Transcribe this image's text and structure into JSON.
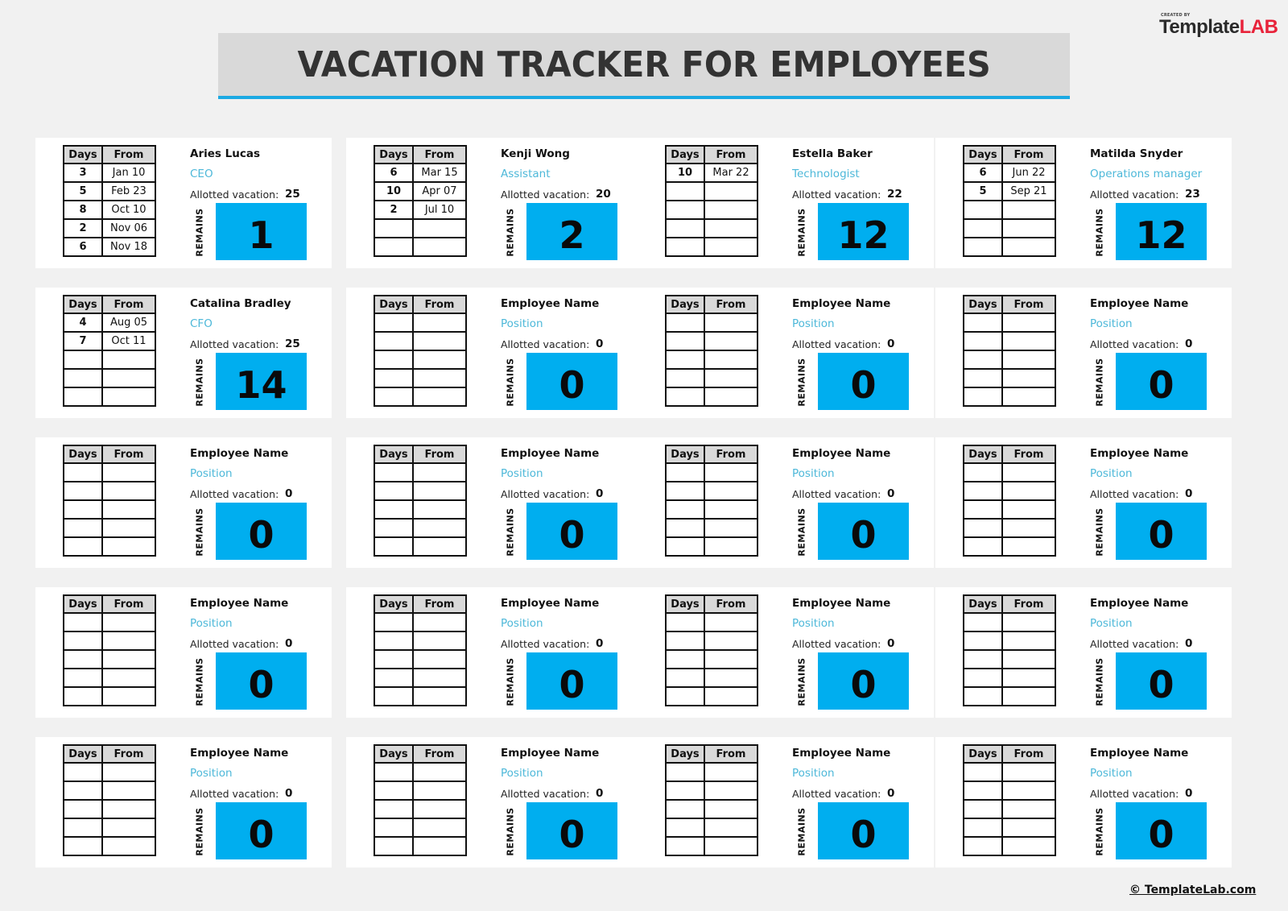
{
  "logo": {
    "created_by": "CREATED BY",
    "brand_part1": "Template",
    "brand_part2": "LAB"
  },
  "title": "VACATION TRACKER FOR EMPLOYEES",
  "table_headers": {
    "days": "Days",
    "from": "From"
  },
  "labels": {
    "allotted": "Allotted vacation:",
    "remains": "REMAINS"
  },
  "colors": {
    "accent": "#00aeef",
    "position_text": "#4db8d9",
    "header_fill": "#d9d9d9",
    "logo_red": "#e8233a"
  },
  "employees": [
    {
      "name": "Aries Lucas",
      "position": "CEO",
      "allotted": "25",
      "remains": "1",
      "rows": [
        {
          "days": "3",
          "from": "Jan 10"
        },
        {
          "days": "5",
          "from": "Feb 23"
        },
        {
          "days": "8",
          "from": "Oct 10"
        },
        {
          "days": "2",
          "from": "Nov 06"
        },
        {
          "days": "6",
          "from": "Nov 18"
        }
      ]
    },
    {
      "name": "Kenji Wong",
      "position": "Assistant",
      "allotted": "20",
      "remains": "2",
      "rows": [
        {
          "days": "6",
          "from": "Mar 15"
        },
        {
          "days": "10",
          "from": "Apr 07"
        },
        {
          "days": "2",
          "from": "Jul 10"
        },
        {
          "days": "",
          "from": ""
        },
        {
          "days": "",
          "from": ""
        }
      ]
    },
    {
      "name": "Estella Baker",
      "position": "Technologist",
      "allotted": "22",
      "remains": "12",
      "rows": [
        {
          "days": "10",
          "from": "Mar 22"
        },
        {
          "days": "",
          "from": ""
        },
        {
          "days": "",
          "from": ""
        },
        {
          "days": "",
          "from": ""
        },
        {
          "days": "",
          "from": ""
        }
      ]
    },
    {
      "name": "Matilda Snyder",
      "position": "Operations manager",
      "allotted": "23",
      "remains": "12",
      "rows": [
        {
          "days": "6",
          "from": "Jun 22"
        },
        {
          "days": "5",
          "from": "Sep 21"
        },
        {
          "days": "",
          "from": ""
        },
        {
          "days": "",
          "from": ""
        },
        {
          "days": "",
          "from": ""
        }
      ]
    },
    {
      "name": "Catalina Bradley",
      "position": "CFO",
      "allotted": "25",
      "remains": "14",
      "rows": [
        {
          "days": "4",
          "from": "Aug 05"
        },
        {
          "days": "7",
          "from": "Oct 11"
        },
        {
          "days": "",
          "from": ""
        },
        {
          "days": "",
          "from": ""
        },
        {
          "days": "",
          "from": ""
        }
      ]
    },
    {
      "name": "Employee Name",
      "position": "Position",
      "allotted": "0",
      "remains": "0",
      "rows": [
        {
          "days": "",
          "from": ""
        },
        {
          "days": "",
          "from": ""
        },
        {
          "days": "",
          "from": ""
        },
        {
          "days": "",
          "from": ""
        },
        {
          "days": "",
          "from": ""
        }
      ]
    },
    {
      "name": "Employee Name",
      "position": "Position",
      "allotted": "0",
      "remains": "0",
      "rows": [
        {
          "days": "",
          "from": ""
        },
        {
          "days": "",
          "from": ""
        },
        {
          "days": "",
          "from": ""
        },
        {
          "days": "",
          "from": ""
        },
        {
          "days": "",
          "from": ""
        }
      ]
    },
    {
      "name": "Employee Name",
      "position": "Position",
      "allotted": "0",
      "remains": "0",
      "rows": [
        {
          "days": "",
          "from": ""
        },
        {
          "days": "",
          "from": ""
        },
        {
          "days": "",
          "from": ""
        },
        {
          "days": "",
          "from": ""
        },
        {
          "days": "",
          "from": ""
        }
      ]
    },
    {
      "name": "Employee Name",
      "position": "Position",
      "allotted": "0",
      "remains": "0",
      "rows": [
        {
          "days": "",
          "from": ""
        },
        {
          "days": "",
          "from": ""
        },
        {
          "days": "",
          "from": ""
        },
        {
          "days": "",
          "from": ""
        },
        {
          "days": "",
          "from": ""
        }
      ]
    },
    {
      "name": "Employee Name",
      "position": "Position",
      "allotted": "0",
      "remains": "0",
      "rows": [
        {
          "days": "",
          "from": ""
        },
        {
          "days": "",
          "from": ""
        },
        {
          "days": "",
          "from": ""
        },
        {
          "days": "",
          "from": ""
        },
        {
          "days": "",
          "from": ""
        }
      ]
    },
    {
      "name": "Employee Name",
      "position": "Position",
      "allotted": "0",
      "remains": "0",
      "rows": [
        {
          "days": "",
          "from": ""
        },
        {
          "days": "",
          "from": ""
        },
        {
          "days": "",
          "from": ""
        },
        {
          "days": "",
          "from": ""
        },
        {
          "days": "",
          "from": ""
        }
      ]
    },
    {
      "name": "Employee Name",
      "position": "Position",
      "allotted": "0",
      "remains": "0",
      "rows": [
        {
          "days": "",
          "from": ""
        },
        {
          "days": "",
          "from": ""
        },
        {
          "days": "",
          "from": ""
        },
        {
          "days": "",
          "from": ""
        },
        {
          "days": "",
          "from": ""
        }
      ]
    },
    {
      "name": "Employee Name",
      "position": "Position",
      "allotted": "0",
      "remains": "0",
      "rows": [
        {
          "days": "",
          "from": ""
        },
        {
          "days": "",
          "from": ""
        },
        {
          "days": "",
          "from": ""
        },
        {
          "days": "",
          "from": ""
        },
        {
          "days": "",
          "from": ""
        }
      ]
    },
    {
      "name": "Employee Name",
      "position": "Position",
      "allotted": "0",
      "remains": "0",
      "rows": [
        {
          "days": "",
          "from": ""
        },
        {
          "days": "",
          "from": ""
        },
        {
          "days": "",
          "from": ""
        },
        {
          "days": "",
          "from": ""
        },
        {
          "days": "",
          "from": ""
        }
      ]
    },
    {
      "name": "Employee Name",
      "position": "Position",
      "allotted": "0",
      "remains": "0",
      "rows": [
        {
          "days": "",
          "from": ""
        },
        {
          "days": "",
          "from": ""
        },
        {
          "days": "",
          "from": ""
        },
        {
          "days": "",
          "from": ""
        },
        {
          "days": "",
          "from": ""
        }
      ]
    },
    {
      "name": "Employee Name",
      "position": "Position",
      "allotted": "0",
      "remains": "0",
      "rows": [
        {
          "days": "",
          "from": ""
        },
        {
          "days": "",
          "from": ""
        },
        {
          "days": "",
          "from": ""
        },
        {
          "days": "",
          "from": ""
        },
        {
          "days": "",
          "from": ""
        }
      ]
    },
    {
      "name": "Employee Name",
      "position": "Position",
      "allotted": "0",
      "remains": "0",
      "rows": [
        {
          "days": "",
          "from": ""
        },
        {
          "days": "",
          "from": ""
        },
        {
          "days": "",
          "from": ""
        },
        {
          "days": "",
          "from": ""
        },
        {
          "days": "",
          "from": ""
        }
      ]
    },
    {
      "name": "Employee Name",
      "position": "Position",
      "allotted": "0",
      "remains": "0",
      "rows": [
        {
          "days": "",
          "from": ""
        },
        {
          "days": "",
          "from": ""
        },
        {
          "days": "",
          "from": ""
        },
        {
          "days": "",
          "from": ""
        },
        {
          "days": "",
          "from": ""
        }
      ]
    },
    {
      "name": "Employee Name",
      "position": "Position",
      "allotted": "0",
      "remains": "0",
      "rows": [
        {
          "days": "",
          "from": ""
        },
        {
          "days": "",
          "from": ""
        },
        {
          "days": "",
          "from": ""
        },
        {
          "days": "",
          "from": ""
        },
        {
          "days": "",
          "from": ""
        }
      ]
    },
    {
      "name": "Employee Name",
      "position": "Position",
      "allotted": "0",
      "remains": "0",
      "rows": [
        {
          "days": "",
          "from": ""
        },
        {
          "days": "",
          "from": ""
        },
        {
          "days": "",
          "from": ""
        },
        {
          "days": "",
          "from": ""
        },
        {
          "days": "",
          "from": ""
        }
      ]
    }
  ],
  "footer": {
    "copyright": "© TemplateLab.com"
  }
}
